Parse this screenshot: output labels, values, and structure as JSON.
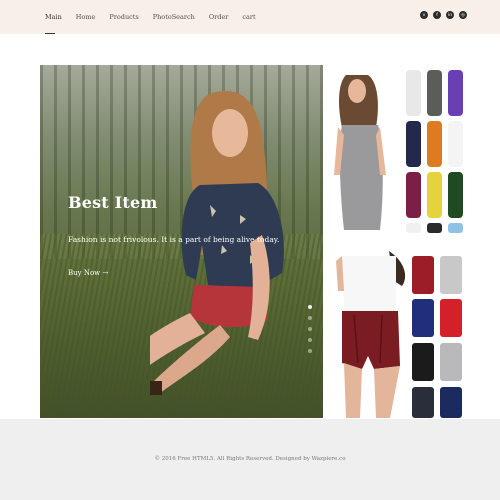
{
  "nav": {
    "items": [
      "Main",
      "Home",
      "Products",
      "PhotoSearch",
      "Order",
      "cart"
    ],
    "active": "Main"
  },
  "social": {
    "icons": [
      {
        "name": "vimeo-icon",
        "glyph": "v"
      },
      {
        "name": "facebook-icon",
        "glyph": "f"
      },
      {
        "name": "linkedin-icon",
        "glyph": "in"
      },
      {
        "name": "dribbble-icon",
        "glyph": "◎"
      }
    ]
  },
  "hero": {
    "title": "Best Item",
    "subtitle": "Fashion is not frivolous. It is a part of being alive today.",
    "button_label": "Buy Now",
    "button_icon": "→",
    "slide_count": 5,
    "active_slide": 1
  },
  "footer": {
    "text": "© 2016 Free HTML5. All Rights Reserved. Designed by Wazpiere.co"
  },
  "colors": {
    "header_bg": "#f8efe8",
    "footer_bg": "#efefef",
    "text_dark": "#333333"
  }
}
